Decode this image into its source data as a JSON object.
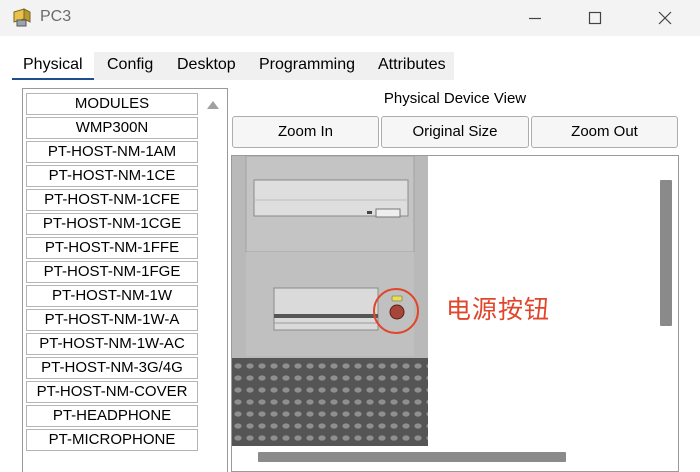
{
  "window": {
    "title": "PC3"
  },
  "tabs": [
    {
      "label": "Physical"
    },
    {
      "label": "Config"
    },
    {
      "label": "Desktop"
    },
    {
      "label": "Programming"
    },
    {
      "label": "Attributes"
    }
  ],
  "modules": {
    "items": [
      {
        "label": "MODULES"
      },
      {
        "label": "WMP300N"
      },
      {
        "label": "PT-HOST-NM-1AM"
      },
      {
        "label": "PT-HOST-NM-1CE"
      },
      {
        "label": "PT-HOST-NM-1CFE"
      },
      {
        "label": "PT-HOST-NM-1CGE"
      },
      {
        "label": "PT-HOST-NM-1FFE"
      },
      {
        "label": "PT-HOST-NM-1FGE"
      },
      {
        "label": "PT-HOST-NM-1W"
      },
      {
        "label": "PT-HOST-NM-1W-A"
      },
      {
        "label": "PT-HOST-NM-1W-AC"
      },
      {
        "label": "PT-HOST-NM-3G/4G"
      },
      {
        "label": "PT-HOST-NM-COVER"
      },
      {
        "label": "PT-HEADPHONE"
      },
      {
        "label": "PT-MICROPHONE"
      }
    ]
  },
  "view": {
    "label": "Physical Device View",
    "zoom_in": "Zoom In",
    "original_size": "Original Size",
    "zoom_out": "Zoom Out"
  },
  "annotation": {
    "power_button": "电源按钮",
    "color": "#e0462b"
  },
  "icons": [
    "app-icon",
    "minimize-icon",
    "maximize-icon",
    "close-icon",
    "scroll-up-icon",
    "power-button-icon"
  ],
  "colors": {
    "active_tab_underline": "#1f4e8c",
    "annotation_red": "#e0462b"
  }
}
